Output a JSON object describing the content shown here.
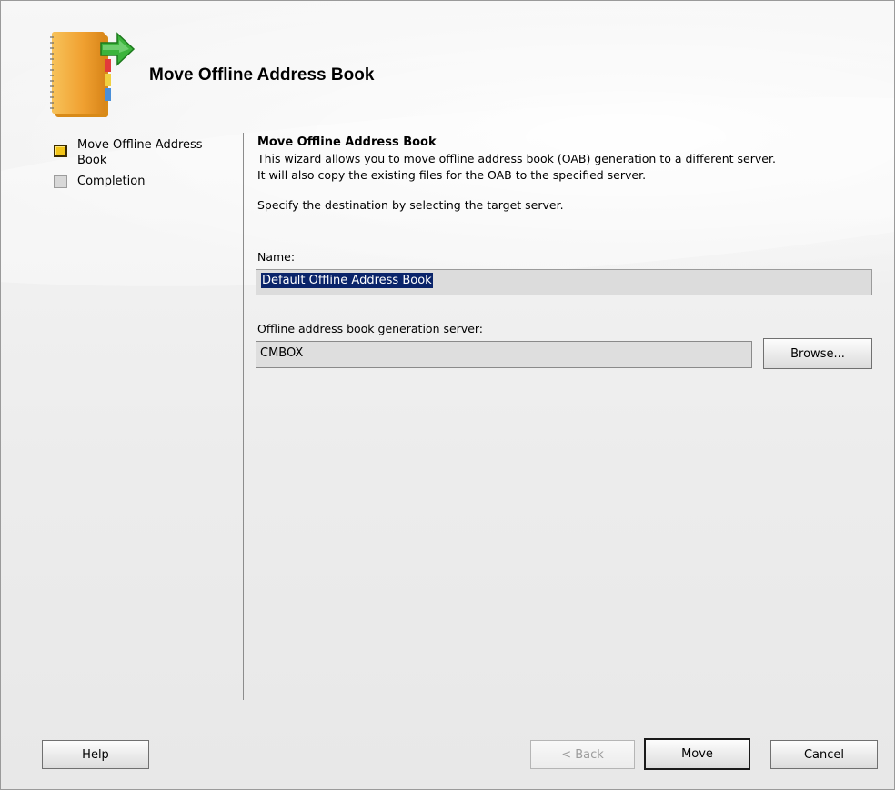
{
  "header": {
    "title": "Move Offline Address Book",
    "icon": "address-book-move-icon"
  },
  "steps": [
    {
      "label": "Move Offline Address Book",
      "state": "active"
    },
    {
      "label": "Completion",
      "state": "pending"
    }
  ],
  "main": {
    "section_title": "Move Offline Address Book",
    "description_line1": "This wizard allows you to move offline address book (OAB) generation to a different server.",
    "description_line2": "It will also copy the existing files for the OAB to the specified server.",
    "instruction": "Specify the destination by selecting the target server.",
    "name_label": "Name:",
    "name_value": "Default Offline Address Book",
    "server_label": "Offline address book generation server:",
    "server_value": "CMBOX",
    "browse_label": "Browse..."
  },
  "buttons": {
    "help": "Help",
    "back": "< Back",
    "move": "Move",
    "cancel": "Cancel"
  },
  "colors": {
    "active_step": "#f2c418",
    "selection": "#0a246a"
  }
}
